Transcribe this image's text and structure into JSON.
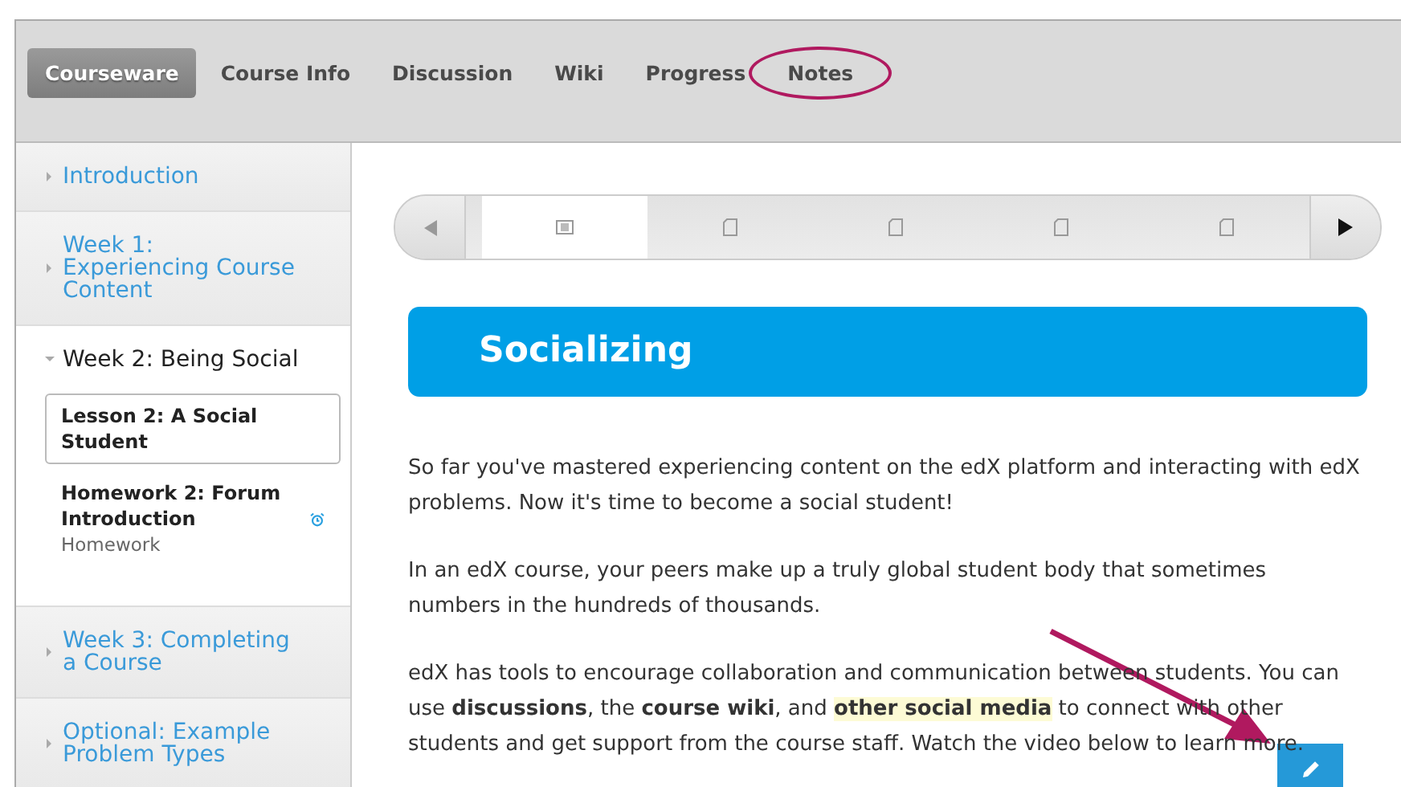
{
  "tabs": [
    {
      "label": "Courseware",
      "selected": true,
      "circled": false
    },
    {
      "label": "Course Info",
      "selected": false,
      "circled": false
    },
    {
      "label": "Discussion",
      "selected": false,
      "circled": false
    },
    {
      "label": "Wiki",
      "selected": false,
      "circled": false
    },
    {
      "label": "Progress",
      "selected": false,
      "circled": false
    },
    {
      "label": "Notes",
      "selected": false,
      "circled": true
    }
  ],
  "sidebar": {
    "chapters": [
      {
        "title": "Introduction",
        "expanded": false
      },
      {
        "title": "Week 1: Experiencing Course Content",
        "expanded": false
      },
      {
        "title": "Week 2: Being Social",
        "expanded": true,
        "children": [
          {
            "title": "Lesson 2: A Social Student",
            "selected": true,
            "due": false
          },
          {
            "title": "Homework 2: Forum Introduction",
            "subtitle": "Homework",
            "selected": false,
            "due": true
          }
        ]
      },
      {
        "title": "Week 3: Completing a Course",
        "expanded": false
      },
      {
        "title": "Optional: Example Problem Types",
        "expanded": false
      }
    ]
  },
  "sequence": {
    "prev_disabled": true,
    "next_disabled": false,
    "units": [
      {
        "kind": "video",
        "selected": true
      },
      {
        "kind": "page",
        "selected": false
      },
      {
        "kind": "page",
        "selected": false
      },
      {
        "kind": "page",
        "selected": false
      },
      {
        "kind": "page",
        "selected": false
      }
    ]
  },
  "heading": "Socializing",
  "paragraphs": [
    [
      {
        "kind": "plain",
        "text": "So far you've mastered experiencing content on the edX platform and interacting with edX problems. Now it's time to become a social student!"
      }
    ],
    [
      {
        "kind": "plain",
        "text": "In an edX course, your peers make up a truly global student body that sometimes numbers in the hundreds of thousands."
      }
    ],
    [
      {
        "kind": "plain",
        "text": "edX has tools to encourage collaboration and communication between students. You can use "
      },
      {
        "kind": "bold",
        "text": "discussions"
      },
      {
        "kind": "plain",
        "text": ", the "
      },
      {
        "kind": "bold",
        "text": "course wiki"
      },
      {
        "kind": "plain",
        "text": ", and "
      },
      {
        "kind": "highlight",
        "text": "other social media"
      },
      {
        "kind": "plain",
        "text": " to connect with other students and get support from the course staff. Watch the video below to learn more."
      }
    ]
  ],
  "annotation": {
    "arrow": true
  }
}
